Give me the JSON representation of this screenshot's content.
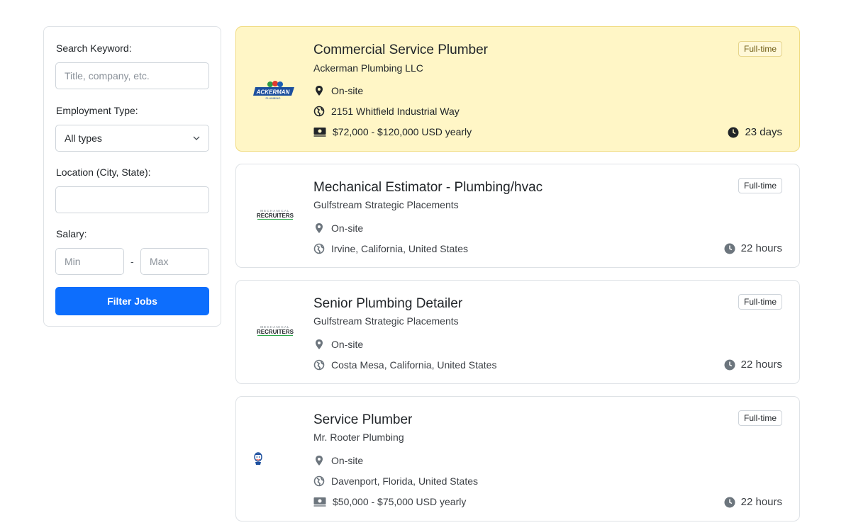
{
  "filters": {
    "keyword_label": "Search Keyword:",
    "keyword_placeholder": "Title, company, etc.",
    "keyword_value": "",
    "employment_label": "Employment Type:",
    "employment_selected": "All types",
    "location_label": "Location (City, State):",
    "location_value": "",
    "salary_label": "Salary:",
    "salary_min_placeholder": "Min",
    "salary_max_placeholder": "Max",
    "salary_separator": "-",
    "filter_button": "Filter Jobs"
  },
  "jobs": [
    {
      "title": "Commercial Service Plumber",
      "company": "Ackerman Plumbing LLC",
      "type": "Full-time",
      "workplace": "On-site",
      "location": "2151 Whitfield Industrial Way",
      "salary": "$72,000 - $120,000 USD yearly",
      "posted": "23 days",
      "logo_text": "ACKERMAN",
      "logo_sub": "PLUMBING",
      "featured": true
    },
    {
      "title": "Mechanical Estimator - Plumbing/hvac",
      "company": "Gulfstream Strategic Placements",
      "type": "Full-time",
      "workplace": "On-site",
      "location": "Irvine, California, United States",
      "posted": "22 hours",
      "logo_text": "RECRUITERS",
      "logo_sub": "MECHANICAL"
    },
    {
      "title": "Senior Plumbing Detailer",
      "company": "Gulfstream Strategic Placements",
      "type": "Full-time",
      "workplace": "On-site",
      "location": "Costa Mesa, California, United States",
      "posted": "22 hours",
      "logo_text": "RECRUITERS",
      "logo_sub": "MECHANICAL"
    },
    {
      "title": "Service Plumber",
      "company": "Mr. Rooter Plumbing",
      "type": "Full-time",
      "workplace": "On-site",
      "location": "Davenport, Florida, United States",
      "salary": "$50,000 - $75,000 USD yearly",
      "posted": "22 hours"
    }
  ],
  "icons": {
    "workplace": "map-pin-icon",
    "location": "globe-icon",
    "salary": "money-icon",
    "posted": "clock-icon",
    "select": "chevron-down-icon"
  },
  "colors": {
    "primary": "#0d6efd",
    "featured_bg": "#fff6c6",
    "featured_border": "#f1dc82"
  }
}
